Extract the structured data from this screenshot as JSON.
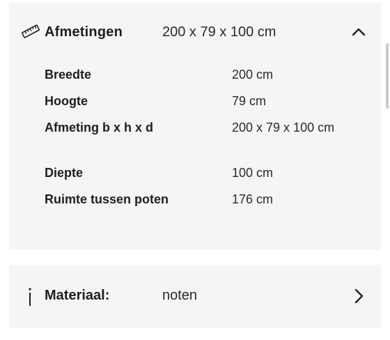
{
  "dimensions": {
    "title": "Afmetingen",
    "summary": "200 x 79 x 100 cm",
    "icon": "ruler-icon",
    "expanded_icon": "chevron-up-icon",
    "specs": [
      {
        "label": "Breedte",
        "value": "200 cm"
      },
      {
        "label": "Hoogte",
        "value": "79 cm"
      },
      {
        "label": "Afmeting b x h x d",
        "value": "200 x 79 x 100 cm"
      },
      {
        "label": "Diepte",
        "value": "100 cm"
      },
      {
        "label": "Ruimte tussen poten",
        "value": "176 cm"
      }
    ]
  },
  "material": {
    "title": "Materiaal:",
    "value": "noten",
    "icon": "info-icon",
    "collapsed_icon": "chevron-right-icon"
  },
  "colors": {
    "card_background": "#f5f5f5",
    "text": "#1f1f1f"
  }
}
